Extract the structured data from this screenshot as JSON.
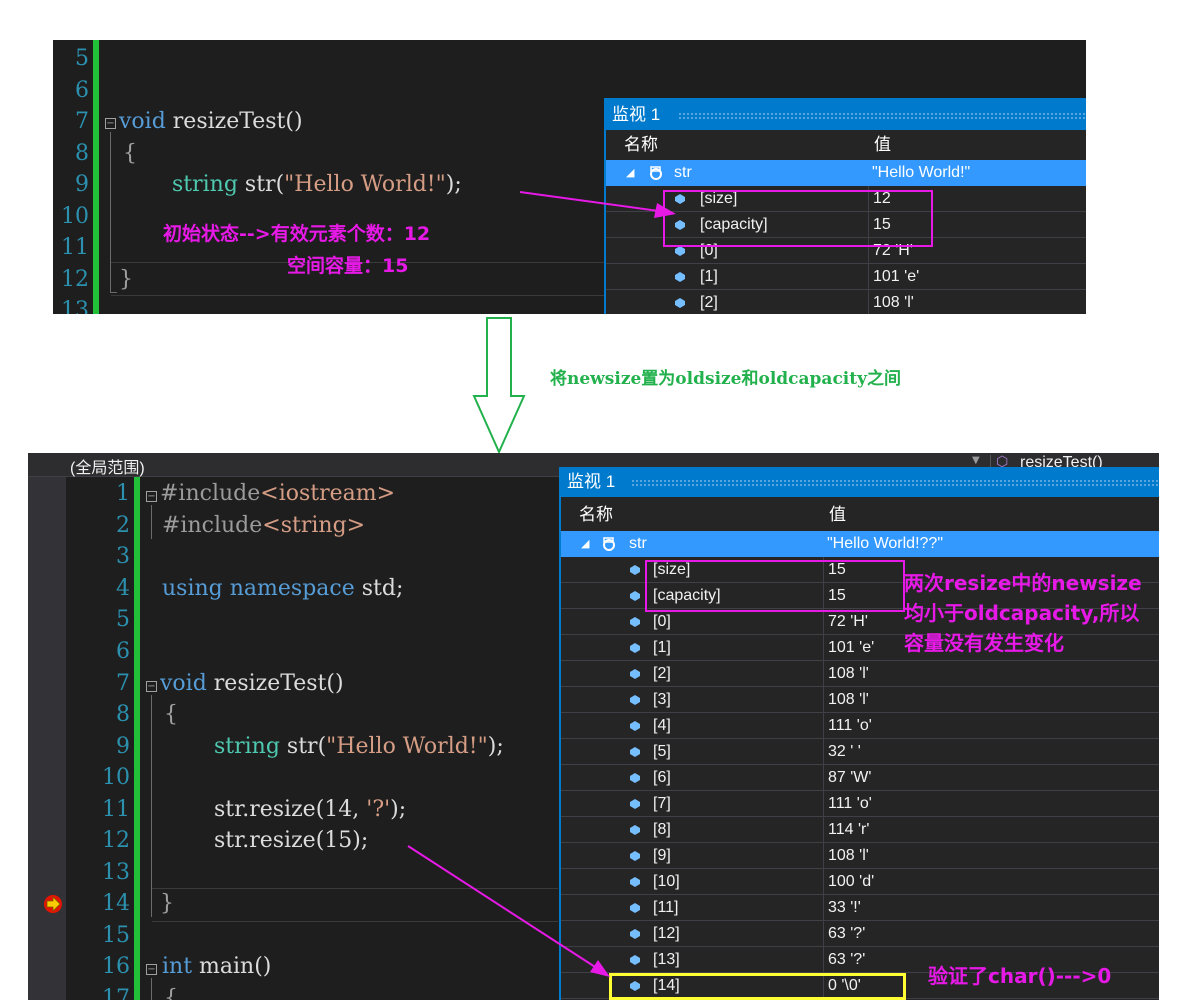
{
  "top_editor": {
    "line_numbers": [
      "5",
      "6",
      "7",
      "8",
      "9",
      "10",
      "11",
      "12",
      "13"
    ],
    "code_void": "void",
    "code_func": " resizeTest()",
    "code_brace_open": "{",
    "code_string_type": "string",
    "code_str_decl": " str(",
    "code_str_literal": "\"Hello World!\"",
    "code_str_end": ");",
    "code_brace_close": "}"
  },
  "top_annotation": {
    "line1": "初始状态-->有效元素个数：12",
    "line2": "空间容量：15"
  },
  "top_watch": {
    "title": "监视 1",
    "col_name": "名称",
    "col_value": "值",
    "rows": [
      {
        "name": "str",
        "value": "\"Hello World!\""
      },
      {
        "name": "[size]",
        "value": "12"
      },
      {
        "name": "[capacity]",
        "value": "15"
      },
      {
        "name": "[0]",
        "value": "72 'H'"
      },
      {
        "name": "[1]",
        "value": "101 'e'"
      },
      {
        "name": "[2]",
        "value": "108 'l'"
      }
    ]
  },
  "transition_label": "将newsize置为oldsize和oldcapacity之间",
  "bottom_editor": {
    "scope_label": "(全局范围)",
    "function_dropdown": "resizeTest()",
    "line_numbers": [
      "1",
      "2",
      "3",
      "4",
      "5",
      "6",
      "7",
      "8",
      "9",
      "10",
      "11",
      "12",
      "13",
      "14",
      "15",
      "16",
      "17"
    ],
    "include1_kw": "#include",
    "include1_hdr": "<iostream>",
    "include2_kw": "#include",
    "include2_hdr": "<string>",
    "using_kw": "using namespace",
    "using_rest": " std;",
    "void_kw": "void",
    "func": " resizeTest()",
    "brace_open": "{",
    "string_type": "string",
    "str_decl": " str(",
    "str_literal": "\"Hello World!\"",
    "str_end": ");",
    "resize1_a": "str.resize(14, ",
    "resize1_lit": "'?'",
    "resize1_b": ");",
    "resize2": "str.resize(15);",
    "brace_close": "}",
    "int_kw": "int",
    "main_func": " main()",
    "main_brace": "{"
  },
  "bottom_watch": {
    "title": "监视 1",
    "col_name": "名称",
    "col_value": "值",
    "rows": [
      {
        "name": "str",
        "value": "\"Hello World!??\""
      },
      {
        "name": "[size]",
        "value": "15"
      },
      {
        "name": "[capacity]",
        "value": "15"
      },
      {
        "name": "[0]",
        "value": "72 'H'"
      },
      {
        "name": "[1]",
        "value": "101 'e'"
      },
      {
        "name": "[2]",
        "value": "108 'l'"
      },
      {
        "name": "[3]",
        "value": "108 'l'"
      },
      {
        "name": "[4]",
        "value": "111 'o'"
      },
      {
        "name": "[5]",
        "value": "32 ' '"
      },
      {
        "name": "[6]",
        "value": "87 'W'"
      },
      {
        "name": "[7]",
        "value": "111 'o'"
      },
      {
        "name": "[8]",
        "value": "114 'r'"
      },
      {
        "name": "[9]",
        "value": "108 'l'"
      },
      {
        "name": "[10]",
        "value": "100 'd'"
      },
      {
        "name": "[11]",
        "value": "33 '!'"
      },
      {
        "name": "[12]",
        "value": "63 '?'"
      },
      {
        "name": "[13]",
        "value": "63 '?'"
      },
      {
        "name": "[14]",
        "value": "0 '\\0'"
      }
    ]
  },
  "bottom_annotation": {
    "line1": "两次resize中的newsize",
    "line2": "均小于oldcapacity,所以",
    "line3": "容量没有发生变化",
    "verify": "验证了char()--->0"
  },
  "colors": {
    "annotation_magenta": "#e619e6",
    "highlight_yellow": "#ffff33",
    "transition_green": "#22b14c",
    "watch_title_blue": "#007acc",
    "selected_row_blue": "#3399ff"
  },
  "icons": {
    "gem": "watch-member-icon",
    "expand": "expand-triangle-icon",
    "breakpoint": "current-statement-arrow-icon"
  }
}
